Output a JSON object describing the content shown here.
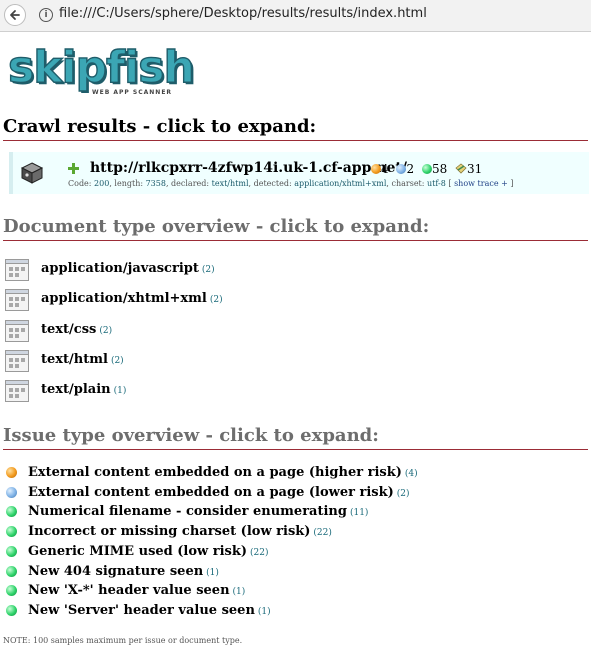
{
  "browser": {
    "url": "file:///C:/Users/sphere/Desktop/results/results/index.html"
  },
  "logo": {
    "wordmark": "skipfish",
    "tagline": "WEB APP SCANNER"
  },
  "sections": {
    "crawl_title": "Crawl results - click to expand:",
    "doc_title": "Document type overview - click to expand:",
    "issue_title": "Issue type overview - click to expand:"
  },
  "crawl": {
    "url": "http://rlkcpxrr-4zfwp14i.uk-1.cf-app.net/",
    "counts": {
      "high": "4",
      "medium": "2",
      "low": "58",
      "info": "31"
    },
    "meta": {
      "code_label": "Code:",
      "code": "200",
      "length_label": ", length:",
      "length": "7358",
      "declared_label": ", declared:",
      "declared": "text/html",
      "detected_label": ", detected:",
      "detected": "application/xhtml+xml",
      "charset_label": ", charset:",
      "charset": "utf-8",
      "trace_open": " [ ",
      "trace_link": "show trace +",
      "trace_close": " ]"
    }
  },
  "doc_types": [
    {
      "label": "application/javascript",
      "count": "(2)"
    },
    {
      "label": "application/xhtml+xml",
      "count": "(2)"
    },
    {
      "label": "text/css",
      "count": "(2)"
    },
    {
      "label": "text/html",
      "count": "(2)"
    },
    {
      "label": "text/plain",
      "count": "(1)"
    }
  ],
  "issues": [
    {
      "label": "External content embedded on a page (higher risk)",
      "count": "(4)",
      "severity": "orange"
    },
    {
      "label": "External content embedded on a page (lower risk)",
      "count": "(2)",
      "severity": "blue"
    },
    {
      "label": "Numerical filename - consider enumerating",
      "count": "(11)",
      "severity": "green"
    },
    {
      "label": "Incorrect or missing charset (low risk)",
      "count": "(22)",
      "severity": "green"
    },
    {
      "label": "Generic MIME used (low risk)",
      "count": "(22)",
      "severity": "green"
    },
    {
      "label": "New 404 signature seen",
      "count": "(1)",
      "severity": "green"
    },
    {
      "label": "New 'X-*' header value seen",
      "count": "(1)",
      "severity": "green"
    },
    {
      "label": "New 'Server' header value seen",
      "count": "(1)",
      "severity": "green"
    }
  ],
  "footer": {
    "note": "NOTE: 100 samples maximum per issue or document type."
  },
  "colors": {
    "accent_rule": "#9b2c36",
    "crawl_bg": "#f0ffff",
    "logo_fill": "#3ba6b4",
    "high": "#f29a1d",
    "medium": "#7fb2e6",
    "low": "#2ed36a"
  },
  "icons": {
    "back": "back-arrow-icon",
    "info": "info-icon",
    "server": "server-icon",
    "expand": "plus-icon",
    "doc_type": "mime-type-icon",
    "severity": "severity-dot-icon",
    "note": "info-note-icon"
  }
}
